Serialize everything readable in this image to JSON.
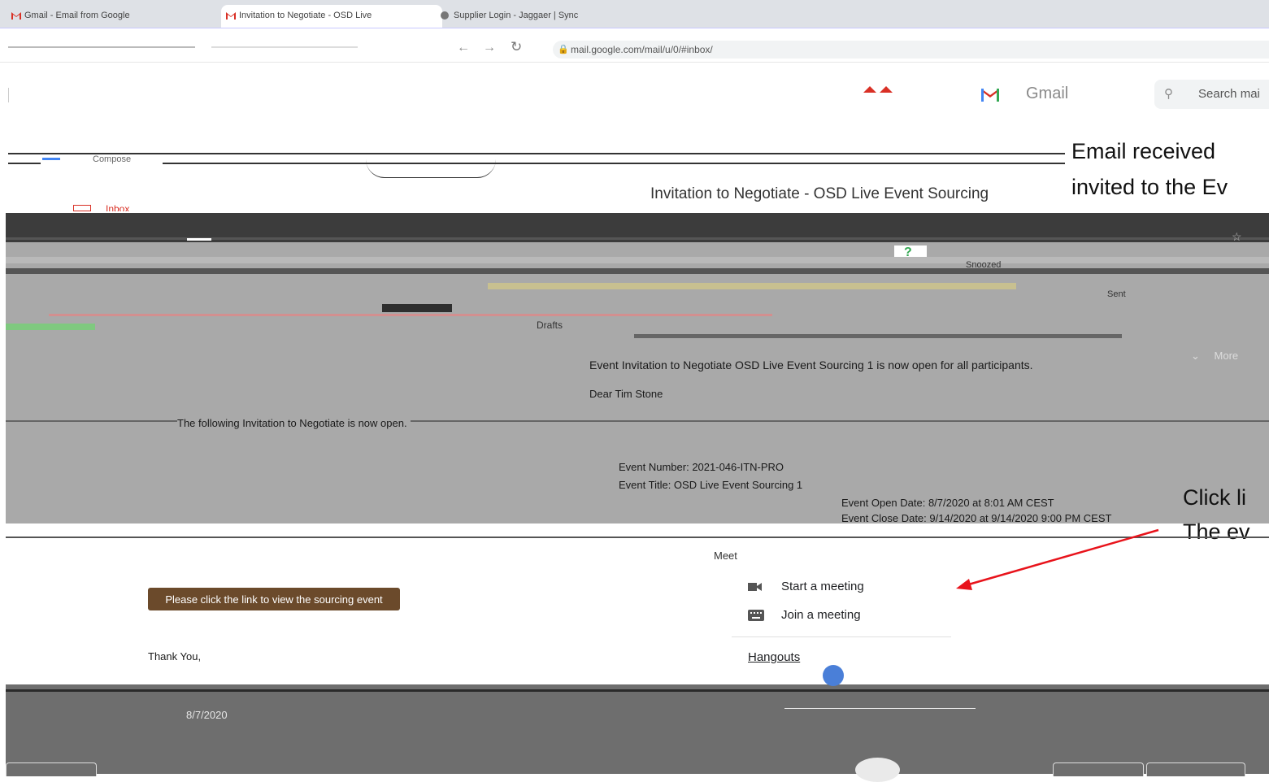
{
  "browser": {
    "tabs": [
      {
        "label": "Gmail - Email from Google"
      },
      {
        "label": "Invitation to Negotiate - OSD Live"
      },
      {
        "label": "Supplier Login - Jaggaer | Sync"
      }
    ],
    "url": "mail.google.com/mail/u/0/#inbox/"
  },
  "gmail": {
    "logo_word": "Gmail",
    "search_placeholder": "Search mai",
    "compose_label": "Compose",
    "inbox_label": "Inbox",
    "snoozed_label": "Snoozed",
    "sent_label": "Sent",
    "drafts_label": "Drafts",
    "subject": "Invitation to Negotiate - OSD Live Event Sourcing",
    "more_label": "More"
  },
  "callouts": {
    "top_line1": "Email received",
    "top_line2": "invited to the Ev",
    "side_line1": "Click li",
    "side_line2": "The ev"
  },
  "email": {
    "headline": "Event Invitation to Negotiate OSD Live Event Sourcing 1 is now open for all participants.",
    "greeting": "Dear Tim Stone",
    "intro": "The following Invitation to Negotiate is now open.",
    "event_number": "Event Number: 2021-046-ITN-PRO",
    "event_title": "Event Title: OSD Live Event Sourcing 1",
    "open_date": "Event Open Date: 8/7/2020 at 8:01 AM CEST",
    "close_date": "Event Close Date: 9/14/2020 at 9/14/2020 9:00 PM CEST",
    "button_label": "Please click the link to view the sourcing event",
    "thanks": "Thank You,",
    "date": "8/7/2020"
  },
  "meet": {
    "heading": "Meet",
    "start": "Start a meeting",
    "join": "Join a meeting",
    "hangouts": "Hangouts"
  },
  "colors": {
    "overlay_gray": "#a9a9a9",
    "button_brown": "#6b4a2b",
    "arrow_red": "#e8131b",
    "gmail_red": "#d93025"
  }
}
